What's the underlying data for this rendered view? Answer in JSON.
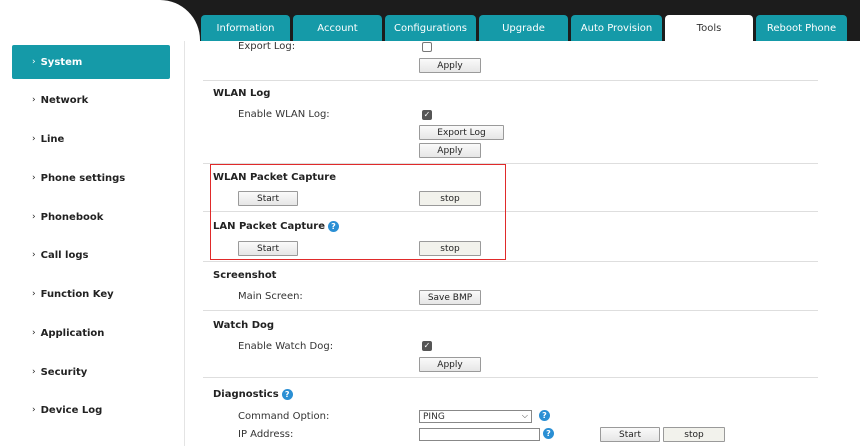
{
  "tabs": [
    {
      "label": "Information"
    },
    {
      "label": "Account"
    },
    {
      "label": "Configurations"
    },
    {
      "label": "Upgrade"
    },
    {
      "label": "Auto Provision"
    },
    {
      "label": "Tools"
    },
    {
      "label": "Reboot Phone"
    }
  ],
  "active_tab": "Tools",
  "sidebar": {
    "items": [
      {
        "label": "System"
      },
      {
        "label": "Network"
      },
      {
        "label": "Line"
      },
      {
        "label": "Phone settings"
      },
      {
        "label": "Phonebook"
      },
      {
        "label": "Call logs"
      },
      {
        "label": "Function Key"
      },
      {
        "label": "Application"
      },
      {
        "label": "Security"
      },
      {
        "label": "Device Log"
      }
    ],
    "active": "System"
  },
  "export_log": {
    "label": "Export Log:",
    "checked": false,
    "apply": "Apply"
  },
  "wlan_log": {
    "title": "WLAN Log",
    "enable_label": "Enable WLAN Log:",
    "checked": true,
    "export_button": "Export Log",
    "apply": "Apply"
  },
  "wlan_capture": {
    "title": "WLAN Packet Capture",
    "start": "Start",
    "stop": "stop"
  },
  "lan_capture": {
    "title": "LAN Packet Capture",
    "start": "Start",
    "stop": "stop"
  },
  "screenshot": {
    "title": "Screenshot",
    "main_label": "Main Screen:",
    "button": "Save BMP"
  },
  "watchdog": {
    "title": "Watch Dog",
    "enable_label": "Enable Watch Dog:",
    "checked": true,
    "apply": "Apply"
  },
  "diagnostics": {
    "title": "Diagnostics",
    "command_label": "Command Option:",
    "command_value": "PING",
    "ip_label": "IP Address:",
    "ip_value": "",
    "start": "Start",
    "stop": "stop"
  },
  "icons": {
    "help": "help-icon",
    "checkbox_check": "check-icon",
    "dropdown": "chevron-down-icon",
    "sidebar_chevron": "chevron-right-icon"
  },
  "colors": {
    "accent": "#159aa8",
    "header": "#1c1c1c",
    "highlight": "#e02a2a",
    "help": "#2a8fd4"
  }
}
